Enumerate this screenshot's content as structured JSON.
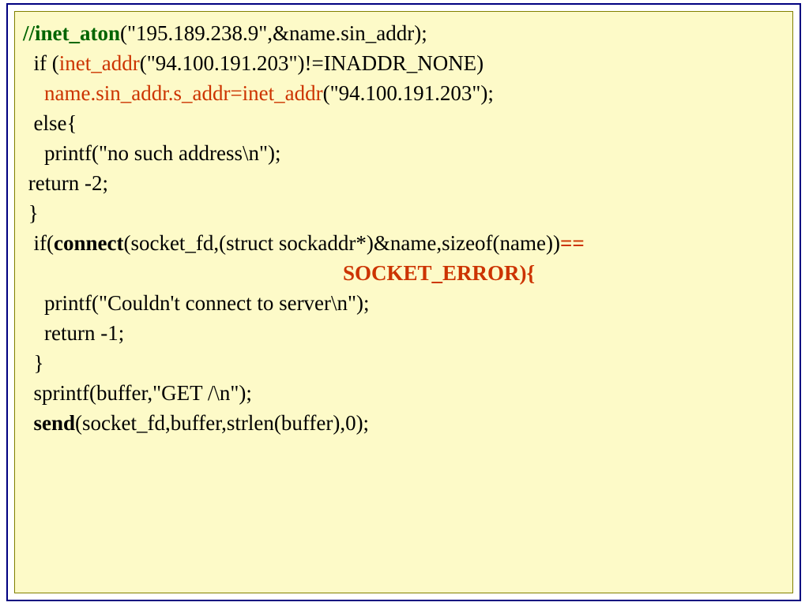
{
  "lines": {
    "l1": {
      "a": "//inet_aton",
      "b": "(\"195.189.238.9\",&name.sin_addr);"
    },
    "l2": {
      "a": "  if (",
      "b": "inet_addr",
      "c": "(\"94.100.191.203\")!=INADDR_NONE)"
    },
    "l3": {
      "a": "    ",
      "b": "name.sin_addr.s_addr=inet_addr",
      "c": "(\"94.100.191.203\");"
    },
    "l4": "  else{",
    "l5": "    printf(\"no such address\\n\");",
    "l6": " return -2;",
    "l7": " }",
    "l8": "",
    "l9": {
      "a": "  if(",
      "b": "connect",
      "c": "(socket_fd,(struct sockaddr*)&name,sizeof(name))",
      "d": "=="
    },
    "l10": {
      "a": "                                                            SOCKET_ERROR){"
    },
    "l11": "    printf(\"Couldn't connect to server\\n\");",
    "l12": "    return -1;",
    "l13": "  }",
    "l14": "  sprintf(buffer,\"GET /\\n\");",
    "l15": "",
    "l16": {
      "a": "  ",
      "b": "send",
      "c": "(socket_fd,buffer,strlen(buffer),0);"
    }
  }
}
